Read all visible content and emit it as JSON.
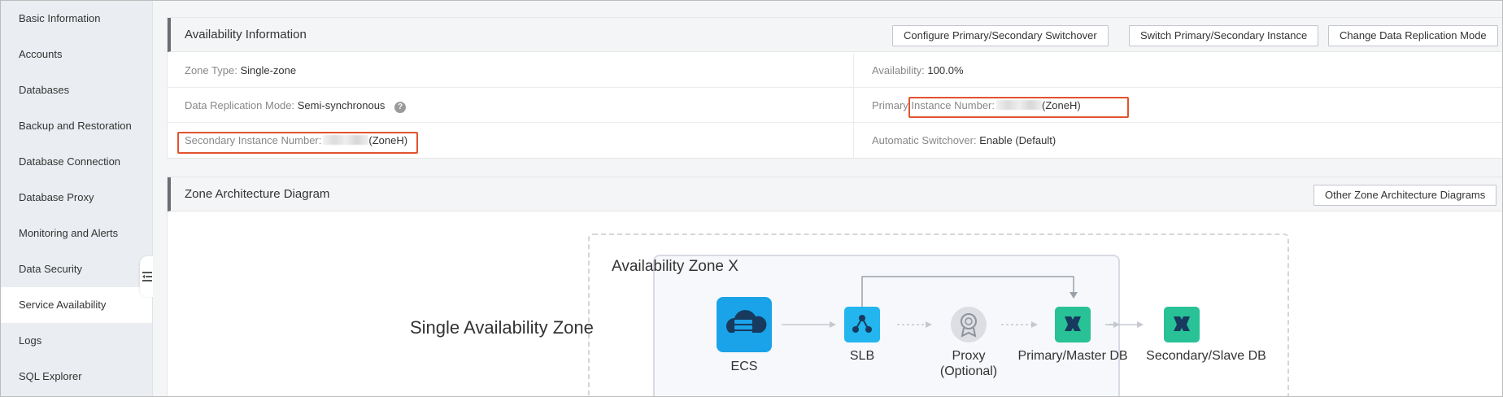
{
  "sidebar": {
    "items": [
      {
        "label": "Basic Information"
      },
      {
        "label": "Accounts"
      },
      {
        "label": "Databases"
      },
      {
        "label": "Backup and Restoration"
      },
      {
        "label": "Database Connection"
      },
      {
        "label": "Database Proxy"
      },
      {
        "label": "Monitoring and Alerts"
      },
      {
        "label": "Data Security"
      },
      {
        "label": "Service Availability"
      },
      {
        "label": "Logs"
      },
      {
        "label": "SQL Explorer"
      }
    ],
    "active_index": 8
  },
  "availability": {
    "title": "Availability Information",
    "buttons": {
      "configure_switchover": "Configure Primary/Secondary Switchover",
      "switch_instance": "Switch Primary/Secondary Instance",
      "change_replication": "Change Data Replication Mode"
    },
    "zone_type": {
      "label": "Zone Type:",
      "value": "Single-zone"
    },
    "availability": {
      "label": "Availability:",
      "value": "100.0%"
    },
    "replication_mode": {
      "label": "Data Replication Mode:",
      "value": "Semi-synchronous",
      "help": "?"
    },
    "primary_instance": {
      "label": "Primary Instance Number:",
      "suffix": "(ZoneH)"
    },
    "secondary_instance": {
      "label": "Secondary Instance Number:",
      "suffix": "(ZoneH)"
    },
    "auto_switchover": {
      "label": "Automatic Switchover:",
      "value": "Enable (Default)"
    }
  },
  "architecture": {
    "title": "Zone Architecture Diagram",
    "other_button": "Other Zone Architecture Diagrams",
    "single_zone_label": "Single Availability Zone",
    "zone_label": "Availability Zone X",
    "nodes": {
      "ecs": "ECS",
      "slb": "SLB",
      "proxy": "Proxy",
      "proxy_note": "(Optional)",
      "primary_db": "Primary/Master DB",
      "secondary_db": "Secondary/Slave DB"
    }
  },
  "colors": {
    "highlight": "#e2532e",
    "ecs_blue": "#1aa3e8",
    "slb_blue": "#22b5ee",
    "db_green": "#28c296",
    "proxy_gray": "#a5a8b0"
  }
}
